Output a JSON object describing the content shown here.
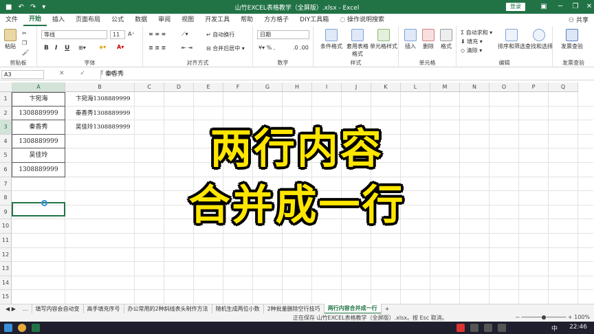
{
  "titlebar": {
    "title": "山竹EXCEL表格教学（全屏版）.xlsx  -  Excel",
    "login": "登录",
    "save_icon": "save-icon",
    "undo_icon": "↶",
    "redo_icon": "↷",
    "minimize": "─",
    "restore": "❐",
    "close": "✕",
    "ribbon_opts": "▣"
  },
  "tabs": [
    "文件",
    "开始",
    "插入",
    "页面布局",
    "公式",
    "数据",
    "审阅",
    "视图",
    "开发工具",
    "帮助",
    "方方格子",
    "DIY工具箱",
    "操作说明搜索"
  ],
  "share": "共享",
  "ribbon": {
    "clipboard": {
      "label": "剪贴板",
      "paste": "粘贴"
    },
    "font": {
      "label": "字体",
      "name": "等线",
      "size": "11",
      "bold": "B",
      "italic": "I",
      "underline": "U"
    },
    "align": {
      "label": "对齐方式",
      "wrap": "自动换行",
      "merge": "合并后居中"
    },
    "number": {
      "label": "数字",
      "format": "日期"
    },
    "styles": {
      "label": "样式",
      "cond": "条件格式",
      "table": "套用表格格式",
      "cell": "单元格样式"
    },
    "cells": {
      "label": "单元格",
      "insert": "插入",
      "delete": "删除",
      "format": "格式"
    },
    "edit": {
      "label": "编辑",
      "autosum": "自动求和",
      "fill": "填充",
      "clear": "清除",
      "sort": "排序和筛选",
      "find": "查找和选择"
    },
    "invoice": {
      "label": "发票查验",
      "btn": "发票查验"
    }
  },
  "formula_bar": {
    "namebox": "A3",
    "icons": "✕ ✓ fx",
    "value": "秦香秀"
  },
  "columns": [
    "A",
    "B",
    "C",
    "D",
    "E",
    "F",
    "G",
    "H",
    "I",
    "J",
    "K",
    "L",
    "M",
    "N",
    "O",
    "P",
    "Q"
  ],
  "rows": [
    "1",
    "2",
    "3",
    "4",
    "5",
    "6",
    "7",
    "8",
    "9",
    "10",
    "11",
    "12",
    "13",
    "14",
    "15"
  ],
  "cells_a": [
    "卞宛海",
    "1308889999",
    "秦香秀",
    "1308889999",
    "吴佳玲",
    "1308889999"
  ],
  "cells_b": [
    "卞宛海1308889999",
    "秦香秀1308889999",
    "吴佳玲1308889999"
  ],
  "overlay": {
    "line1": "两行内容",
    "line2": "合并成一行"
  },
  "sheet_tabs": [
    "...",
    "填写内容会自动变",
    "高手填充序号",
    "办公常用的2种斜线表头制作方法",
    "随机生成两位小数",
    "2种批量删除空行技巧",
    "两行内容合并成一行",
    "+"
  ],
  "status": {
    "text": "正在保存 山竹EXCEL表格教学（全屏版）.xlsx。按 Esc 取消。",
    "zoom": "100%"
  },
  "taskbar": {
    "time": "22:46",
    "ime": "中"
  }
}
